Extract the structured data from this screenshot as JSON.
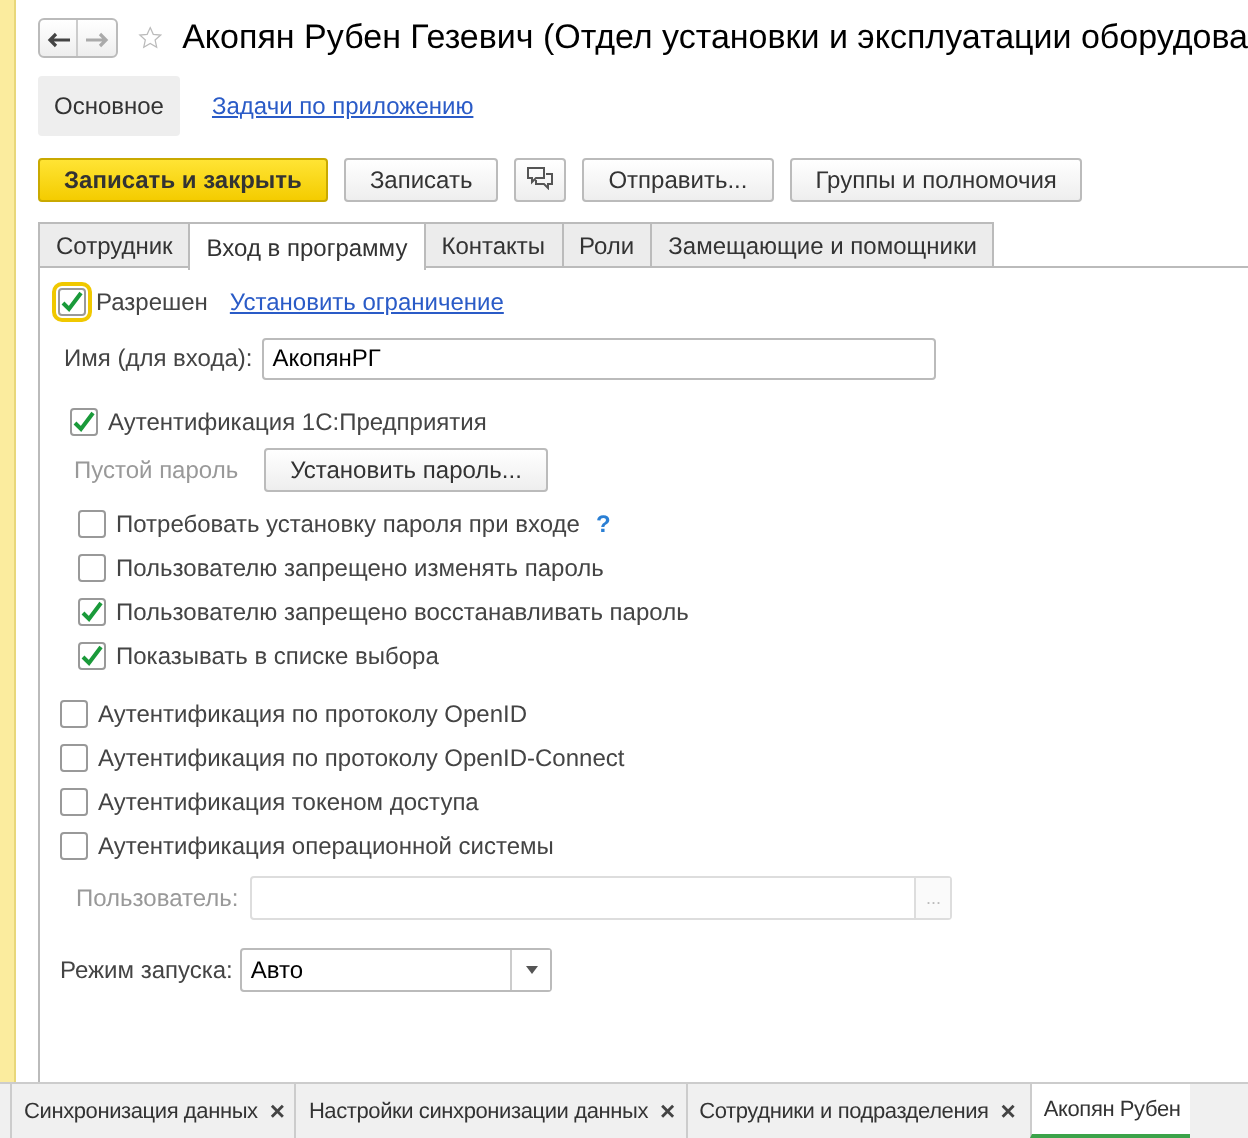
{
  "window": {
    "title": "Акопян Рубен Гезевич (Отдел установки и эксплуатации оборудова",
    "favorite": false
  },
  "sections": [
    {
      "label": "Основное",
      "selected": true
    },
    {
      "label": "Задачи по приложению",
      "selected": false
    }
  ],
  "toolbar": [
    {
      "kind": "primary",
      "label": "Записать и закрыть"
    },
    {
      "kind": "normal",
      "label": "Записать"
    },
    {
      "kind": "icon"
    },
    {
      "kind": "normal",
      "label": "Отправить..."
    },
    {
      "kind": "normal",
      "label": "Группы и полномочия"
    }
  ],
  "tabs": [
    {
      "label": "Сотрудник",
      "selected": false
    },
    {
      "label": "Вход в программу",
      "selected": true
    },
    {
      "label": "Контакты",
      "selected": false
    },
    {
      "label": "Роли",
      "selected": false
    },
    {
      "label": "Замещающие и помощники",
      "selected": false
    }
  ],
  "allowed": {
    "label": "Разрешен",
    "checked": true,
    "link": "Установить ограничение"
  },
  "login": {
    "label": "Имя (для входа):",
    "value": "АкопянРГ"
  },
  "auth_1c": {
    "label": "Аутентификация 1С:Предприятия",
    "checked": true,
    "password_status": "Пустой пароль",
    "password_button": "Установить пароль...",
    "options": [
      {
        "label": "Потребовать установку пароля при входе",
        "checked": false,
        "help": "?"
      },
      {
        "label": "Пользователю запрещено изменять пароль",
        "checked": false
      },
      {
        "label": "Пользователю запрещено восстанавливать пароль",
        "checked": true
      },
      {
        "label": "Показывать в списке выбора",
        "checked": true
      }
    ]
  },
  "other_auth": [
    {
      "label": "Аутентификация по протоколу OpenID",
      "checked": false
    },
    {
      "label": "Аутентификация по протоколу OpenID-Connect",
      "checked": false
    },
    {
      "label": "Аутентификация токеном доступа",
      "checked": false
    },
    {
      "label": "Аутентификация операционной системы",
      "checked": false
    }
  ],
  "os_user": {
    "label": "Пользователь:",
    "disabled": true,
    "button": "..."
  },
  "launch_mode": {
    "label": "Режим запуска:",
    "value": "Авто"
  },
  "open_windows": [
    {
      "label": "Синхронизация данных",
      "selected": false,
      "close": "×"
    },
    {
      "label": "Настройки синхронизации данных",
      "selected": false,
      "close": "×"
    },
    {
      "label": "Сотрудники и подразделения",
      "selected": false,
      "close": "×"
    },
    {
      "label": "Акопян Рубен",
      "selected": true
    }
  ]
}
